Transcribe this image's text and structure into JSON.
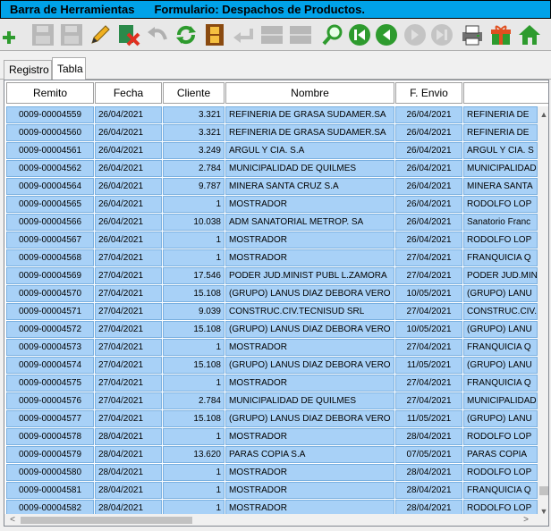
{
  "titlebar": {
    "app_label": "Barra de Herramientas",
    "form_label": "Formulario: Despachos de Productos."
  },
  "toolbar": {
    "buttons": [
      {
        "name": "add-button",
        "icon": "plus-icon"
      },
      {
        "name": "save-button",
        "icon": "save-icon"
      },
      {
        "name": "save-as-button",
        "icon": "save-icon"
      },
      {
        "name": "edit-button",
        "icon": "pencil-icon"
      },
      {
        "name": "cancel-button",
        "icon": "cancel-icon"
      },
      {
        "name": "undo-button",
        "icon": "undo-icon"
      },
      {
        "name": "refresh-button",
        "icon": "refresh-icon"
      },
      {
        "name": "film-button",
        "icon": "film-icon"
      },
      {
        "name": "return-button",
        "icon": "return-icon"
      },
      {
        "name": "grid1-button",
        "icon": "grid-icon"
      },
      {
        "name": "grid2-button",
        "icon": "grid-icon"
      },
      {
        "name": "search-button",
        "icon": "search-icon"
      },
      {
        "name": "first-button",
        "icon": "first-icon"
      },
      {
        "name": "prev-button",
        "icon": "prev-icon"
      },
      {
        "name": "next-button",
        "icon": "next-icon"
      },
      {
        "name": "last-button",
        "icon": "last-icon"
      },
      {
        "name": "print-button",
        "icon": "printer-icon"
      },
      {
        "name": "gift-button",
        "icon": "gift-icon"
      },
      {
        "name": "home-button",
        "icon": "home-icon"
      }
    ]
  },
  "tabs": [
    {
      "label": "Registro",
      "active": false
    },
    {
      "label": "Tabla",
      "active": true
    }
  ],
  "table": {
    "columns": [
      "Remito",
      "Fecha",
      "Cliente",
      "Nombre",
      "F. Envio",
      ""
    ],
    "rows": [
      [
        "0009-00004559",
        "26/04/2021",
        "3.321",
        "REFINERIA DE GRASA SUDAMER.SA",
        "26/04/2021",
        "REFINERIA DE"
      ],
      [
        "0009-00004560",
        "26/04/2021",
        "3.321",
        "REFINERIA DE GRASA SUDAMER.SA",
        "26/04/2021",
        "REFINERIA DE"
      ],
      [
        "0009-00004561",
        "26/04/2021",
        "3.249",
        "ARGUL Y CIA. S.A",
        "26/04/2021",
        "ARGUL Y CIA. S"
      ],
      [
        "0009-00004562",
        "26/04/2021",
        "2.784",
        "MUNICIPALIDAD DE QUILMES",
        "26/04/2021",
        "MUNICIPALIDAD"
      ],
      [
        "0009-00004564",
        "26/04/2021",
        "9.787",
        "MINERA SANTA CRUZ S.A",
        "26/04/2021",
        "MINERA SANTA"
      ],
      [
        "0009-00004565",
        "26/04/2021",
        "1",
        "MOSTRADOR",
        "26/04/2021",
        "RODOLFO LOP"
      ],
      [
        "0009-00004566",
        "26/04/2021",
        "10.038",
        "ADM SANATORIAL METROP. SA",
        "26/04/2021",
        "Sanatorio Franc"
      ],
      [
        "0009-00004567",
        "26/04/2021",
        "1",
        "MOSTRADOR",
        "26/04/2021",
        "RODOLFO LOP"
      ],
      [
        "0009-00004568",
        "27/04/2021",
        "1",
        "MOSTRADOR",
        "27/04/2021",
        "FRANQUICIA Q"
      ],
      [
        "0009-00004569",
        "27/04/2021",
        "17.546",
        "PODER JUD.MINIST PUBL L.ZAMORA",
        "27/04/2021",
        "PODER JUD.MIN"
      ],
      [
        "0009-00004570",
        "27/04/2021",
        "15.108",
        "(GRUPO) LANUS DIAZ DEBORA VERO",
        "10/05/2021",
        "(GRUPO) LANU"
      ],
      [
        "0009-00004571",
        "27/04/2021",
        "9.039",
        "CONSTRUC.CIV.TECNISUD SRL",
        "27/04/2021",
        "CONSTRUC.CIV."
      ],
      [
        "0009-00004572",
        "27/04/2021",
        "15.108",
        "(GRUPO) LANUS DIAZ DEBORA VERO",
        "10/05/2021",
        "(GRUPO) LANU"
      ],
      [
        "0009-00004573",
        "27/04/2021",
        "1",
        "MOSTRADOR",
        "27/04/2021",
        "FRANQUICIA Q"
      ],
      [
        "0009-00004574",
        "27/04/2021",
        "15.108",
        "(GRUPO) LANUS DIAZ DEBORA VERO",
        "11/05/2021",
        "(GRUPO) LANU"
      ],
      [
        "0009-00004575",
        "27/04/2021",
        "1",
        "MOSTRADOR",
        "27/04/2021",
        "FRANQUICIA Q"
      ],
      [
        "0009-00004576",
        "27/04/2021",
        "2.784",
        "MUNICIPALIDAD DE QUILMES",
        "27/04/2021",
        "MUNICIPALIDAD"
      ],
      [
        "0009-00004577",
        "27/04/2021",
        "15.108",
        "(GRUPO) LANUS DIAZ DEBORA VERO",
        "11/05/2021",
        "(GRUPO) LANU"
      ],
      [
        "0009-00004578",
        "28/04/2021",
        "1",
        "MOSTRADOR",
        "28/04/2021",
        "RODOLFO LOP"
      ],
      [
        "0009-00004579",
        "28/04/2021",
        "13.620",
        "PARAS COPIA S.A",
        "07/05/2021",
        "PARAS COPIA"
      ],
      [
        "0009-00004580",
        "28/04/2021",
        "1",
        "MOSTRADOR",
        "28/04/2021",
        "RODOLFO LOP"
      ],
      [
        "0009-00004581",
        "28/04/2021",
        "1",
        "MOSTRADOR",
        "28/04/2021",
        "FRANQUICIA Q"
      ],
      [
        "0009-00004582",
        "28/04/2021",
        "1",
        "MOSTRADOR",
        "28/04/2021",
        "RODOLFO LOP"
      ]
    ]
  },
  "scrollbar": {
    "up_glyph": "▲",
    "down_glyph": "▼",
    "left_glyph": "<",
    "right_glyph": ">",
    "vertical_position": 0.97,
    "horizontal_position": 0.0
  },
  "colors": {
    "titlebar": "#00a2e8",
    "row_fill": "#a8d1f7",
    "row_border": "#7ab0e0"
  }
}
